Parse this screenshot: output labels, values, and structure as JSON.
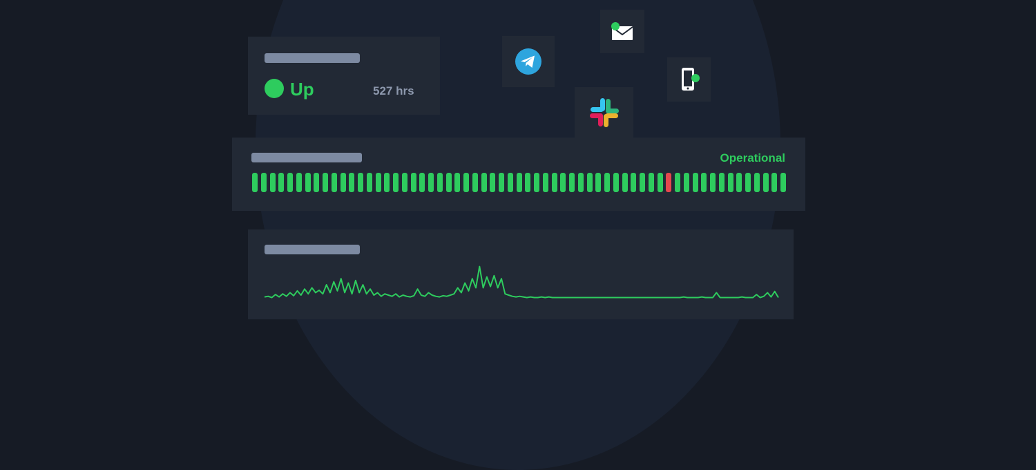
{
  "status_card": {
    "status": "Up",
    "uptime": "527 hrs",
    "status_color": "#2ecc5e"
  },
  "notification_channels": [
    {
      "name": "telegram-icon"
    },
    {
      "name": "email-icon"
    },
    {
      "name": "sms-icon"
    },
    {
      "name": "slack-icon"
    }
  ],
  "uptime_card": {
    "status_text": "Operational",
    "colors": {
      "up": "#2ecc5e",
      "down": "#e5484d"
    },
    "checks": [
      "up",
      "up",
      "up",
      "up",
      "up",
      "up",
      "up",
      "up",
      "up",
      "up",
      "up",
      "up",
      "up",
      "up",
      "up",
      "up",
      "up",
      "up",
      "up",
      "up",
      "up",
      "up",
      "up",
      "up",
      "up",
      "up",
      "up",
      "up",
      "up",
      "up",
      "up",
      "up",
      "up",
      "up",
      "up",
      "up",
      "up",
      "up",
      "up",
      "up",
      "up",
      "up",
      "up",
      "up",
      "up",
      "up",
      "up",
      "down",
      "up",
      "up",
      "up",
      "up",
      "up",
      "up",
      "up",
      "up",
      "up",
      "up",
      "up",
      "up",
      "up"
    ]
  },
  "chart_data": {
    "type": "line",
    "title": "",
    "xlabel": "",
    "ylabel": "",
    "color": "#2ecc5e",
    "series": [
      {
        "values": [
          0.05,
          0.06,
          0.04,
          0.09,
          0.05,
          0.1,
          0.06,
          0.12,
          0.07,
          0.15,
          0.08,
          0.18,
          0.1,
          0.2,
          0.12,
          0.16,
          0.1,
          0.25,
          0.12,
          0.3,
          0.15,
          0.35,
          0.12,
          0.28,
          0.1,
          0.32,
          0.12,
          0.25,
          0.1,
          0.18,
          0.08,
          0.12,
          0.06,
          0.1,
          0.08,
          0.06,
          0.1,
          0.05,
          0.08,
          0.06,
          0.05,
          0.07,
          0.18,
          0.08,
          0.06,
          0.12,
          0.08,
          0.06,
          0.05,
          0.07,
          0.06,
          0.08,
          0.1,
          0.2,
          0.12,
          0.28,
          0.15,
          0.35,
          0.2,
          0.55,
          0.2,
          0.38,
          0.22,
          0.4,
          0.2,
          0.35,
          0.1,
          0.08,
          0.06,
          0.05,
          0.06,
          0.05,
          0.04,
          0.05,
          0.04,
          0.04,
          0.05,
          0.04,
          0.05,
          0.04,
          0.04,
          0.04,
          0.04,
          0.04,
          0.04,
          0.04,
          0.04,
          0.04,
          0.04,
          0.04,
          0.04,
          0.04,
          0.04,
          0.04,
          0.04,
          0.04,
          0.04,
          0.04,
          0.04,
          0.04,
          0.04,
          0.04,
          0.04,
          0.04,
          0.04,
          0.04,
          0.04,
          0.04,
          0.04,
          0.04,
          0.04,
          0.04,
          0.04,
          0.04,
          0.04,
          0.05,
          0.04,
          0.04,
          0.04,
          0.04,
          0.05,
          0.04,
          0.04,
          0.04,
          0.12,
          0.04,
          0.04,
          0.04,
          0.04,
          0.04,
          0.04,
          0.05,
          0.04,
          0.04,
          0.04,
          0.09,
          0.04,
          0.06,
          0.12,
          0.05,
          0.14,
          0.04
        ],
        "name": ""
      }
    ],
    "grid": false
  }
}
